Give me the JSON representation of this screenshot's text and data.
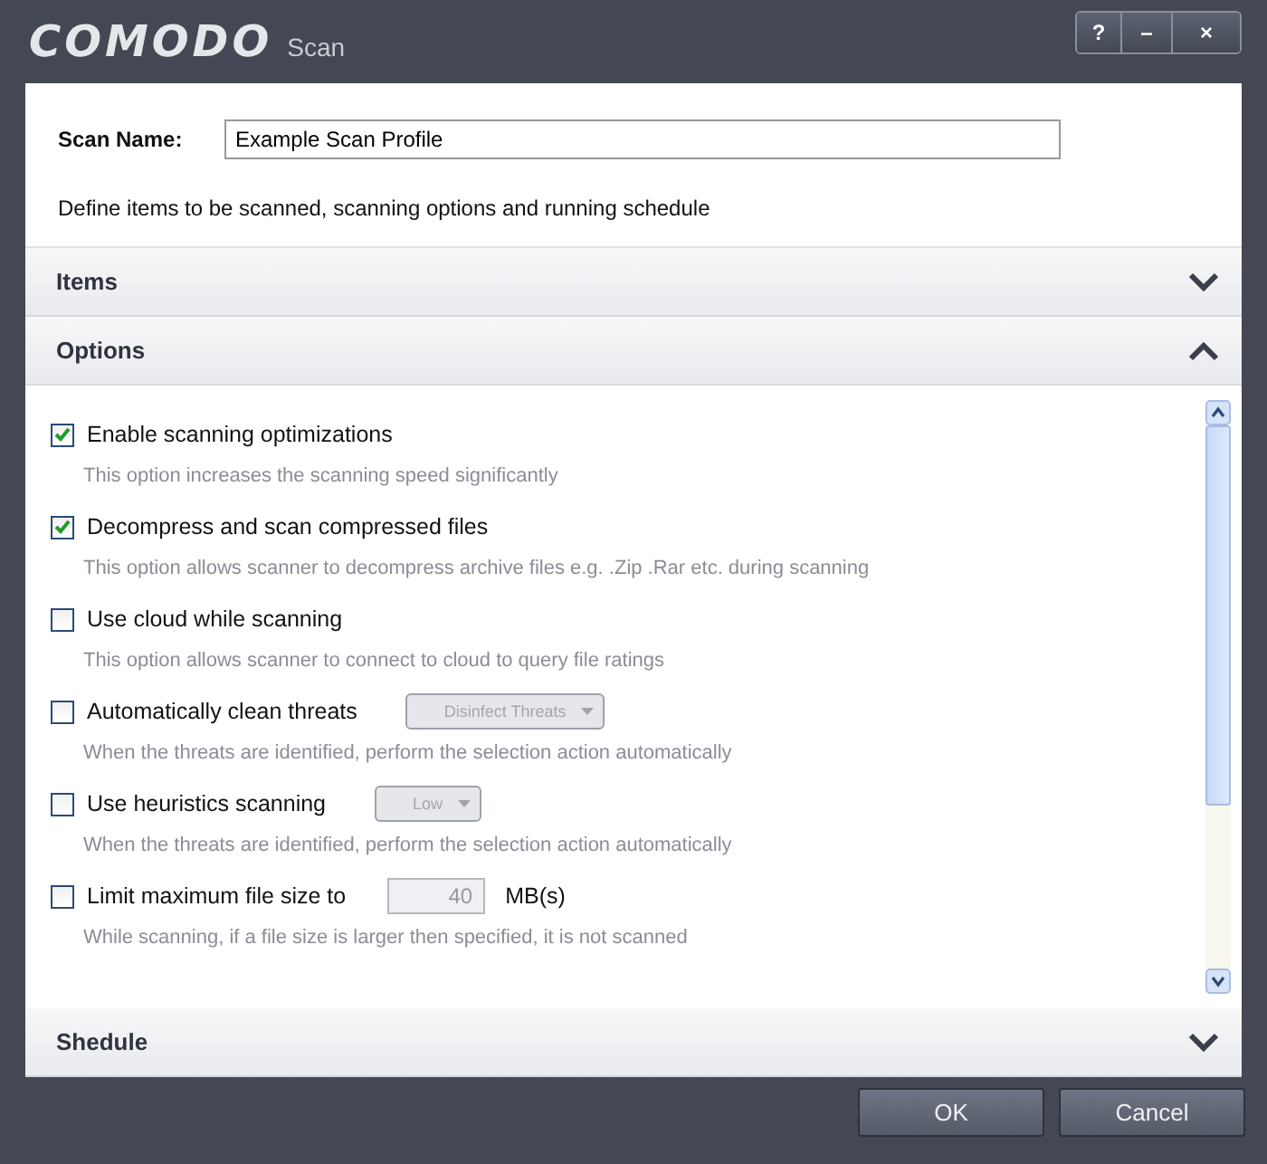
{
  "window": {
    "logo": "COMODO",
    "title": "Scan",
    "controls": [
      "?",
      "–",
      "×"
    ]
  },
  "scan_name": {
    "label": "Scan Name:",
    "value": "Example Scan Profile"
  },
  "description": "Define items to be scanned, scanning options and running schedule",
  "sections": [
    {
      "title": "Items",
      "expanded": false
    },
    {
      "title": "Options",
      "expanded": true
    }
  ],
  "options": [
    {
      "kind": "plain",
      "label": "Enable scanning optimizations",
      "checked": true,
      "hint": "This option increases the scanning speed significantly"
    },
    {
      "kind": "plain",
      "label": "Decompress and scan compressed files",
      "checked": true,
      "hint": "This option allows scanner to decompress archive files e.g. .Zip .Rar etc. during scanning"
    },
    {
      "kind": "plain",
      "label": "Use cloud while scanning",
      "checked": false,
      "hint": "This option allows scanner to connect to cloud to query file ratings"
    },
    {
      "kind": "select",
      "label": "Automatically clean threats",
      "checked": false,
      "control": "Disinfect Threats",
      "hint": "When the threats are identified, perform the selection action automatically"
    },
    {
      "kind": "select",
      "label": "Use heuristics scanning",
      "checked": false,
      "control": "Low",
      "hint": "When the threats are identified, perform the selection action automatically"
    },
    {
      "kind": "number",
      "label": "Limit maximum file size to",
      "checked": false,
      "control": "40",
      "unit": "MB(s)",
      "hint": "While scanning, if a file size is larger then specified, it is not scanned"
    }
  ],
  "footer_section": {
    "title": "Shedule",
    "expanded": false
  },
  "buttons": [
    "OK",
    "Cancel"
  ]
}
